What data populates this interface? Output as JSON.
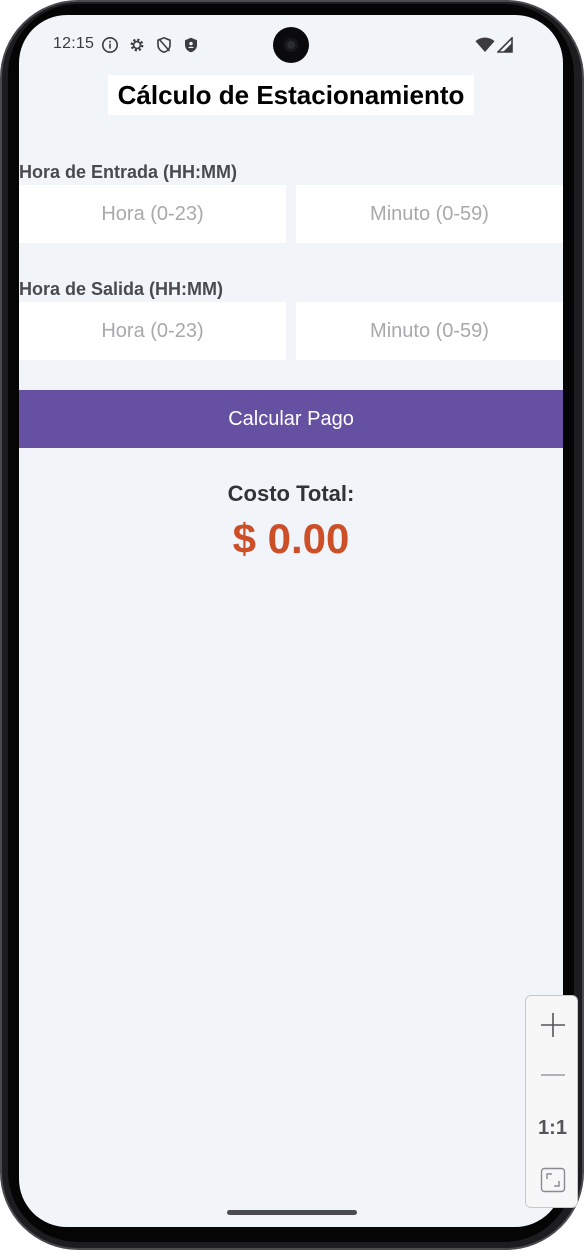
{
  "status_bar": {
    "time": "12:15",
    "left_icons": [
      "info-icon",
      "gear-icon",
      "shield-outline-icon",
      "shield-filled-icon"
    ],
    "right_icons": [
      "wifi-icon",
      "signal-icon"
    ]
  },
  "app": {
    "title": "Cálculo de Estacionamiento",
    "entry": {
      "label": "Hora de Entrada (HH:MM)",
      "hour_placeholder": "Hora (0-23)",
      "minute_placeholder": "Minuto (0-59)",
      "hour_value": "",
      "minute_value": ""
    },
    "exit": {
      "label": "Hora de Salida (HH:MM)",
      "hour_placeholder": "Hora (0-23)",
      "minute_placeholder": "Minuto (0-59)",
      "hour_value": "",
      "minute_value": ""
    },
    "calculate_button_label": "Calcular Pago",
    "total_cost_label": "Costo Total:",
    "total_cost_value": "$ 0.00"
  },
  "zoom_controls": {
    "zoom_in_icon": "plus-icon",
    "zoom_out_icon": "minus-icon",
    "reset_label": "1:1",
    "fit_icon": "fit-screen-icon"
  },
  "colors": {
    "screen_background": "#f1f4f9",
    "button_background": "#6650a2",
    "button_text": "#ffffff",
    "cost_value": "#cc4f27",
    "label_text": "#4a4a4e",
    "placeholder_text": "#a9a9ad"
  }
}
